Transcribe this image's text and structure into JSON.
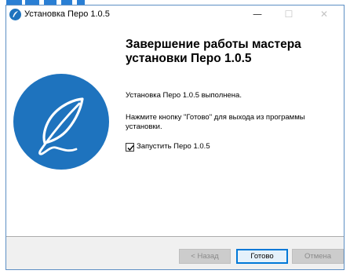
{
  "window": {
    "title": "Установка Перо 1.0.5",
    "minimize_glyph": "—",
    "maximize_glyph": "☐",
    "close_glyph": "✕",
    "app_icon": "feather-icon"
  },
  "main": {
    "heading": "Завершение работы мастера установки Перо 1.0.5",
    "status_text": "Установка Перо 1.0.5 выполнена.",
    "hint_text": "Нажмите кнопку \"Готово\" для выхода из программы установки.",
    "launch_checkbox": {
      "label": "Запустить Перо 1.0.5",
      "checked": true
    },
    "logo_icon": "feather-icon"
  },
  "buttons": {
    "back_label": "< Назад",
    "finish_label": "Готово",
    "cancel_label": "Отмена"
  },
  "colors": {
    "brand_blue": "#1e73be",
    "focus_blue": "#0078d7"
  }
}
